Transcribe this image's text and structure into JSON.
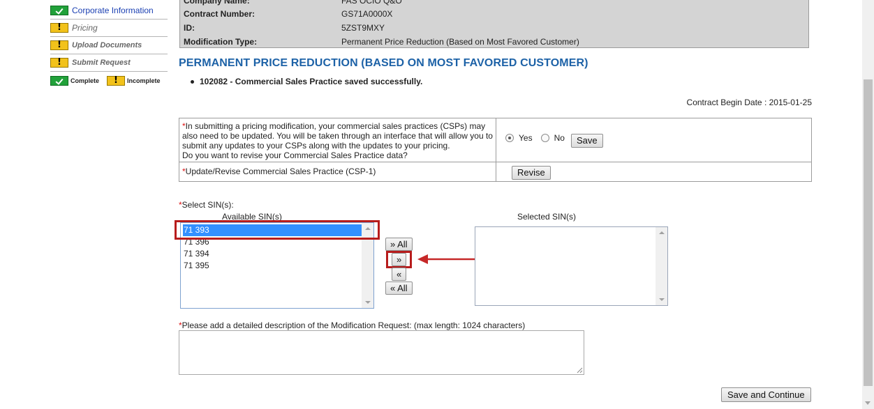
{
  "sidebar": {
    "items": [
      {
        "label": "Corporate Information",
        "status": "complete"
      },
      {
        "label": "Pricing",
        "status": "incomplete"
      },
      {
        "label": "Upload Documents",
        "status": "incomplete"
      },
      {
        "label": "Submit Request",
        "status": "incomplete"
      }
    ],
    "legend": {
      "complete": "Complete",
      "incomplete": "Incomplete"
    }
  },
  "info": {
    "company_label": "Company Name:",
    "company_value": "FAS OCIO Q&O",
    "contract_label": "Contract Number:",
    "contract_value": "GS71A0000X",
    "id_label": "ID:",
    "id_value": "5ZST9MXY",
    "modtype_label": "Modification Type:",
    "modtype_value": "Permanent Price Reduction (Based on Most Favored Customer)"
  },
  "page_title": "PERMANENT PRICE REDUCTION (BASED ON MOST FAVORED CUSTOMER)",
  "success_message": "102082 - Commercial Sales Practice saved successfully.",
  "contract_begin_date": "Contract Begin Date : 2015-01-25",
  "csp": {
    "question": "In submitting a pricing modification, your commercial sales practices (CSPs) may also need to be updated. You will be taken through an interface that will allow you to submit any updates to your CSPs along with the updates to your pricing.",
    "question2": "Do you want to revise your Commercial Sales Practice data?",
    "yes_label": "Yes",
    "no_label": "No",
    "selected": "Yes",
    "save_label": "Save",
    "update_label": "Update/Revise Commercial Sales Practice (CSP-1)",
    "revise_label": "Revise"
  },
  "sin": {
    "select_label": "Select SIN(s):",
    "available_label": "Available SIN(s)",
    "selected_label": "Selected SIN(s)",
    "available": [
      "71 393",
      "71 396",
      "71 394",
      "71 395"
    ],
    "selected_item": "71 393",
    "selected": [],
    "move_all_right": "» All",
    "move_right": "»",
    "move_left": "«",
    "move_all_left": "« All"
  },
  "description": {
    "label": "Please add a detailed description of the Modification Request: (max length: 1024 characters)",
    "value": ""
  },
  "save_continue_label": "Save and Continue",
  "colors": {
    "title": "#1d62a7",
    "complete": "#21a13a",
    "incomplete": "#f2c21b",
    "highlight": "#b71c1c",
    "selection": "#3390ff"
  }
}
